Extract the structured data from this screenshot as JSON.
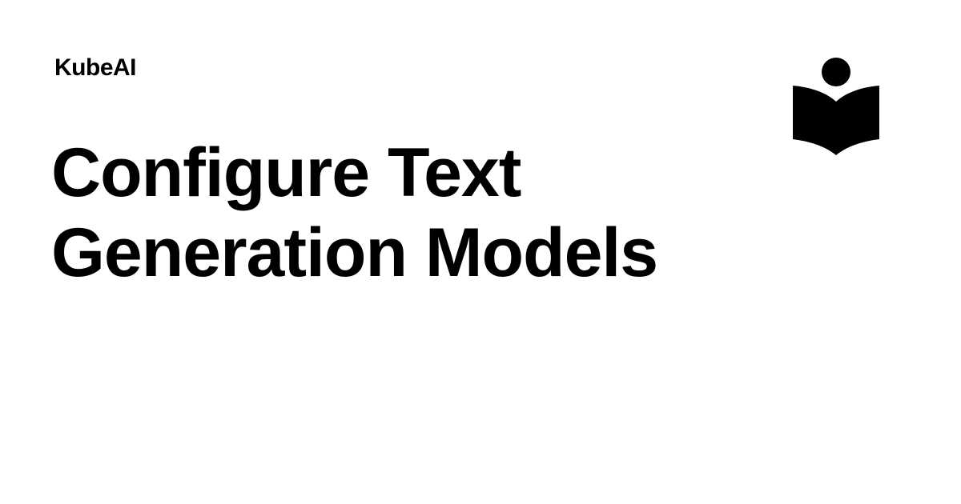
{
  "site": {
    "name": "KubeAI"
  },
  "page": {
    "title_line_1": "Configure Text",
    "title_line_2": "Generation Models"
  },
  "logo": {
    "icon": "reader-book-icon",
    "color": "#000000"
  },
  "colors": {
    "background": "#ffffff",
    "text": "#000000"
  }
}
